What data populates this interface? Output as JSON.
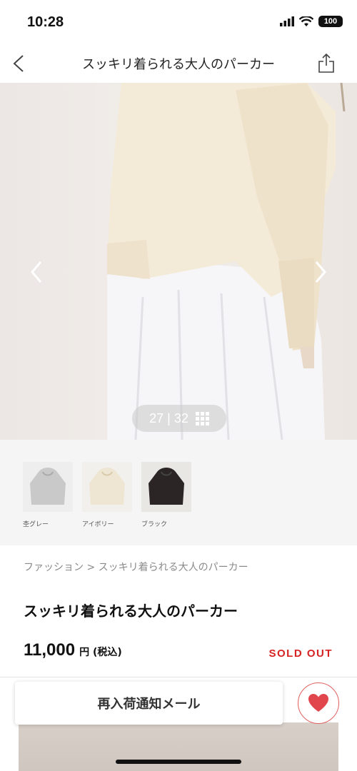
{
  "status_bar": {
    "time": "10:28",
    "battery": "100"
  },
  "nav": {
    "title": "スッキリ着られる大人のパーカー"
  },
  "gallery": {
    "counter": "27 | 32"
  },
  "swatches": [
    {
      "label": "杢グレー",
      "color": "#c9c9c9"
    },
    {
      "label": "アイボリー",
      "color": "#efe5d3"
    },
    {
      "label": "ブラック",
      "color": "#2b2526"
    }
  ],
  "breadcrumb": "ファッション > スッキリ着られる大人のパーカー",
  "product": {
    "title": "スッキリ着られる大人のパーカー",
    "price": "11,000",
    "price_unit": "円 (税込)",
    "status": "SOLD OUT"
  },
  "actions": {
    "restock_label": "再入荷通知メール"
  },
  "colors": {
    "accent_red": "#d62323",
    "heart": "#e0464b"
  }
}
